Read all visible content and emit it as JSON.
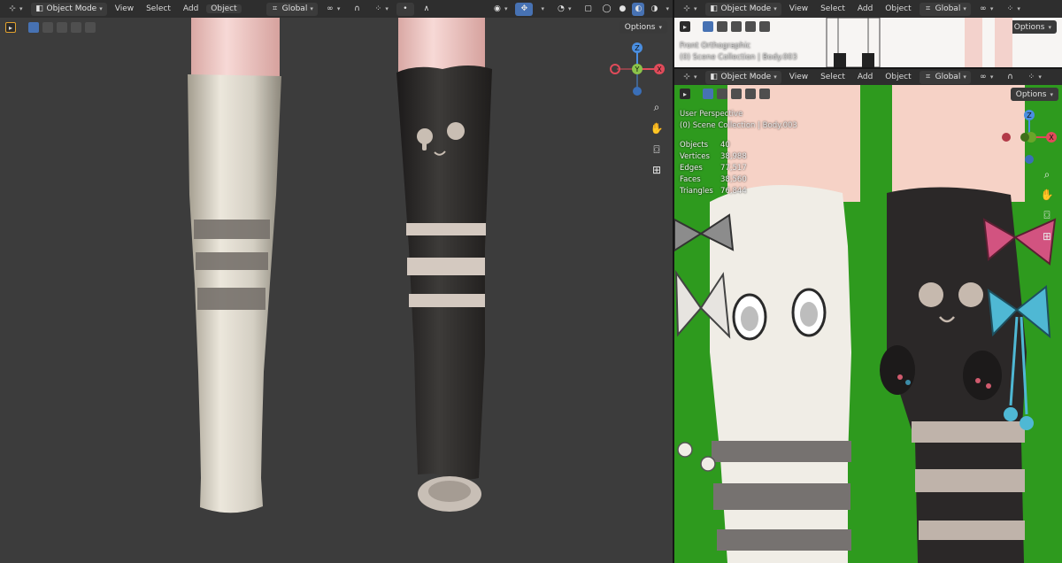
{
  "left_view": {
    "header": {
      "mode": "Object Mode",
      "menus": [
        "View",
        "Select",
        "Add",
        "Object"
      ],
      "transform_orientation": "Global"
    },
    "options_label": "Options",
    "gizmo": {
      "y": "Y",
      "z": "Z",
      "x": "X"
    }
  },
  "top_right_view": {
    "header": {
      "mode": "Object Mode",
      "menus": [
        "View",
        "Select",
        "Add",
        "Object"
      ],
      "transform_orientation": "Global"
    },
    "options_label": "Options",
    "view_name": "Front Orthographic",
    "collection_line": "(0) Scene Collection | Body.003"
  },
  "bottom_right_view": {
    "header": {
      "mode": "Object Mode",
      "menus": [
        "View",
        "Select",
        "Add",
        "Object"
      ],
      "transform_orientation": "Global"
    },
    "options_label": "Options",
    "view_name": "User Perspective",
    "collection_line": "(0) Scene Collection | Body.003",
    "stats": [
      {
        "label": "Objects",
        "value": "40"
      },
      {
        "label": "Vertices",
        "value": "38,988"
      },
      {
        "label": "Edges",
        "value": "77,517"
      },
      {
        "label": "Faces",
        "value": "38,560"
      },
      {
        "label": "Triangles",
        "value": "76,844"
      }
    ],
    "gizmo": {
      "z": "Z",
      "x": "X"
    }
  },
  "icons": {
    "editor_type": "viewport-editor-icon",
    "mode_cube": "cube-icon",
    "link": "chain-icon",
    "snap": "magnet-icon",
    "grid": "grid-icon",
    "falloff": "falloff-icon",
    "visibility": "eye-icon",
    "gizmo_toggle": "gizmo-icon",
    "overlay": "overlay-icon",
    "xray": "xray-icon",
    "shading_wire": "wireframe-shading-icon",
    "shading_solid": "solid-shading-icon",
    "shading_material": "material-shading-icon",
    "shading_render": "rendered-shading-icon",
    "zoom": "zoom-icon",
    "pan": "hand-icon",
    "camera": "camera-icon",
    "ortho": "grid-toggle-icon"
  },
  "colors": {
    "viewport_bg": "#3c3c3c",
    "green_bg": "#2e9a1e",
    "header_bg": "#2f2f2f",
    "accent_blue": "#4772b3",
    "axis_x": "#e04b5a",
    "axis_y": "#8bc34a",
    "axis_z": "#4a8ee0"
  }
}
